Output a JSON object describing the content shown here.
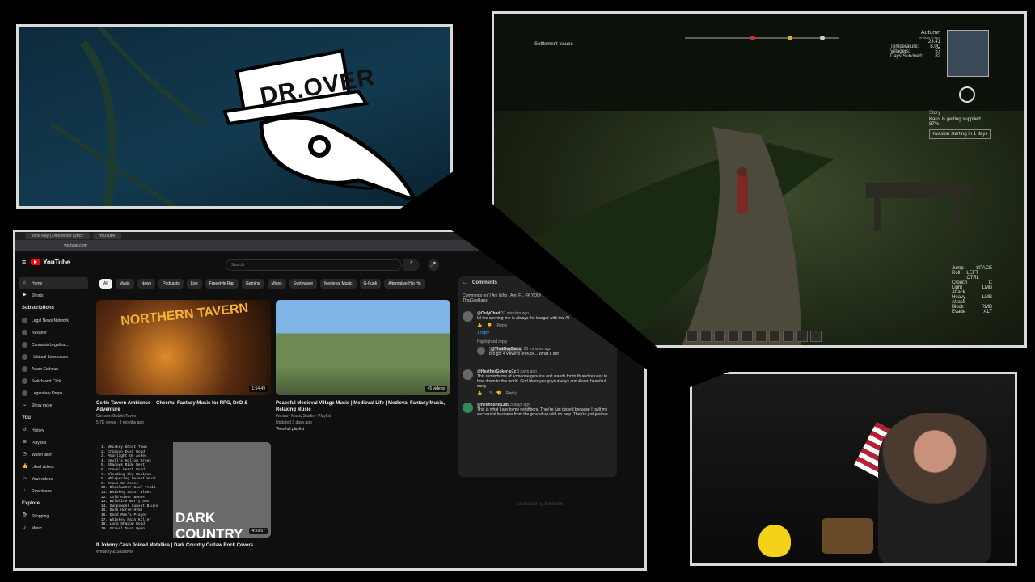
{
  "logo": {
    "text": "DR.OVER"
  },
  "game": {
    "season": "Autumn",
    "season_sub": "ends in 8 days",
    "time": "23:41",
    "stats": [
      {
        "label": "Temperature:",
        "value": "8.0C"
      },
      {
        "label": "Villagers:",
        "value": "57"
      },
      {
        "label": "Days Survived:",
        "value": "82"
      }
    ],
    "notice_title": "Story",
    "notice_1": "Karol is getting supplied 87%",
    "notice_2": "Invasion starting in 1 days",
    "quest": "Settlement Issues",
    "controls": [
      {
        "action": "Jump",
        "key": "SPACE"
      },
      {
        "action": "Roll",
        "key": "LEFT CTRL"
      },
      {
        "action": "Crouch",
        "key": "C"
      },
      {
        "action": "Light Attack",
        "key": "LMB"
      },
      {
        "action": "Heavy Attack",
        "key": "LMB"
      },
      {
        "action": "Block",
        "key": "RMB"
      },
      {
        "action": "Evade",
        "key": "ALT"
      }
    ]
  },
  "browser": {
    "tabs": [
      "Jona Ray | Dino Mode Lyrics",
      "YouTube"
    ],
    "url": "youtube.com"
  },
  "youtube": {
    "logo": "YouTube",
    "search_placeholder": "Search",
    "sidebar_main": [
      "Home",
      "Shorts"
    ],
    "subscriptions_title": "Subscriptions",
    "subscriptions": [
      "Legal News Network",
      "Nuxanor",
      "Cannabis Legalizat...",
      "Habitual Linecrosser",
      "Adam Calhoun",
      "Switch and Click",
      "Legendary Drops"
    ],
    "show_more": "Show more",
    "you_title": "You",
    "you_items": [
      "History",
      "Playlists",
      "Watch later",
      "Liked videos",
      "Your videos",
      "Downloads"
    ],
    "explore_title": "Explore",
    "explore_items": [
      "Shopping",
      "Music"
    ],
    "chips": [
      "All",
      "Music",
      "News",
      "Podcasts",
      "Live",
      "Freestyle Rap",
      "Gaming",
      "Mixes",
      "Synthwave",
      "Medieval Music",
      "G-Funk",
      "Alternative Hip Ho"
    ],
    "videos": [
      {
        "title": "Celtic Tavern Ambience – Cheerful Fantasy Music for RPG, DnD & Adventure",
        "channel": "Crimson Goblet Tavern",
        "meta": "5.7K views · 8 months ago",
        "duration": "1:54:49",
        "thumb_text": "NORTHERN TAVERN"
      },
      {
        "title": "Peaceful Medieval Village Music | Medieval Life | Medieval Fantasy Music, Relaxing Music",
        "channel": "Fantasy Music Studio · Playlist",
        "meta": "Updated 3 days ago",
        "extra": "View full playlist",
        "duration": "45 videos"
      },
      {
        "title": "If Johnny Cash Joined Metallica | Dark Country Outlaw Rock Covers",
        "channel": "Whiskey & Shadows",
        "duration": "4:59:57",
        "thumb_text": "DARK COUNTRY"
      }
    ],
    "tracklist": [
      "1. Whiskey Ghost Town",
      "2. Crimson Dust Road",
      "3. Moonlight On Ashes",
      "4. Devil's Hollow Creek",
      "5. Shadows Ride West",
      "6. Gravel Heart Road",
      "7. Bleeding Sky Horizon",
      "8. Whispering Desert Wind",
      "9. Crows On Fence",
      "10. Blackwater Soul Trail",
      "11. Whiskey Saint Blues",
      "12. Cold River Bones",
      "13. Wildfire Worry Sun",
      "14. Gunpowder Sunset Blues",
      "15. Dark Horse Hymn",
      "16. Dead Man's Prayer",
      "17. Whiskey Rain Killer",
      "18. Long Shadow Road",
      "19. Gravel Dust Hymn"
    ]
  },
  "comments": {
    "title": "Comments",
    "context": "Comments on 'I Am Who I Am, F... FK YOU! (Lyrical Lyrics) | Outlaw Rap Ba...' ThatGuyBanx",
    "items": [
      {
        "author": "@OnlyChad",
        "time": "37 minutes ago",
        "text": "lol the opening line is always the banger with this AI"
      },
      {
        "author": "@ThatGuyBanx",
        "time": "25 minutes ago",
        "text": "bro got 4 viewers on Kick... What a life!",
        "tag": "Highlighted reply"
      },
      {
        "author": "@HeatherGoker-o7z",
        "time": "3 days ago",
        "text": "This reminds me of someone genuine and stands for truth and refuses to bow down to this world. God bless you guys always and 4ever. beautiful song"
      },
      {
        "author": "@hellhound1389",
        "time": "5 days ago",
        "text": "This is what I say to my neighbors. They're just pissed because I built my successful business from the ground up with no help. They're just jealous"
      }
    ],
    "reply_label": "Reply",
    "replies_label": "1 reply",
    "likes": "13",
    "watermark": "produced by Eminem"
  }
}
